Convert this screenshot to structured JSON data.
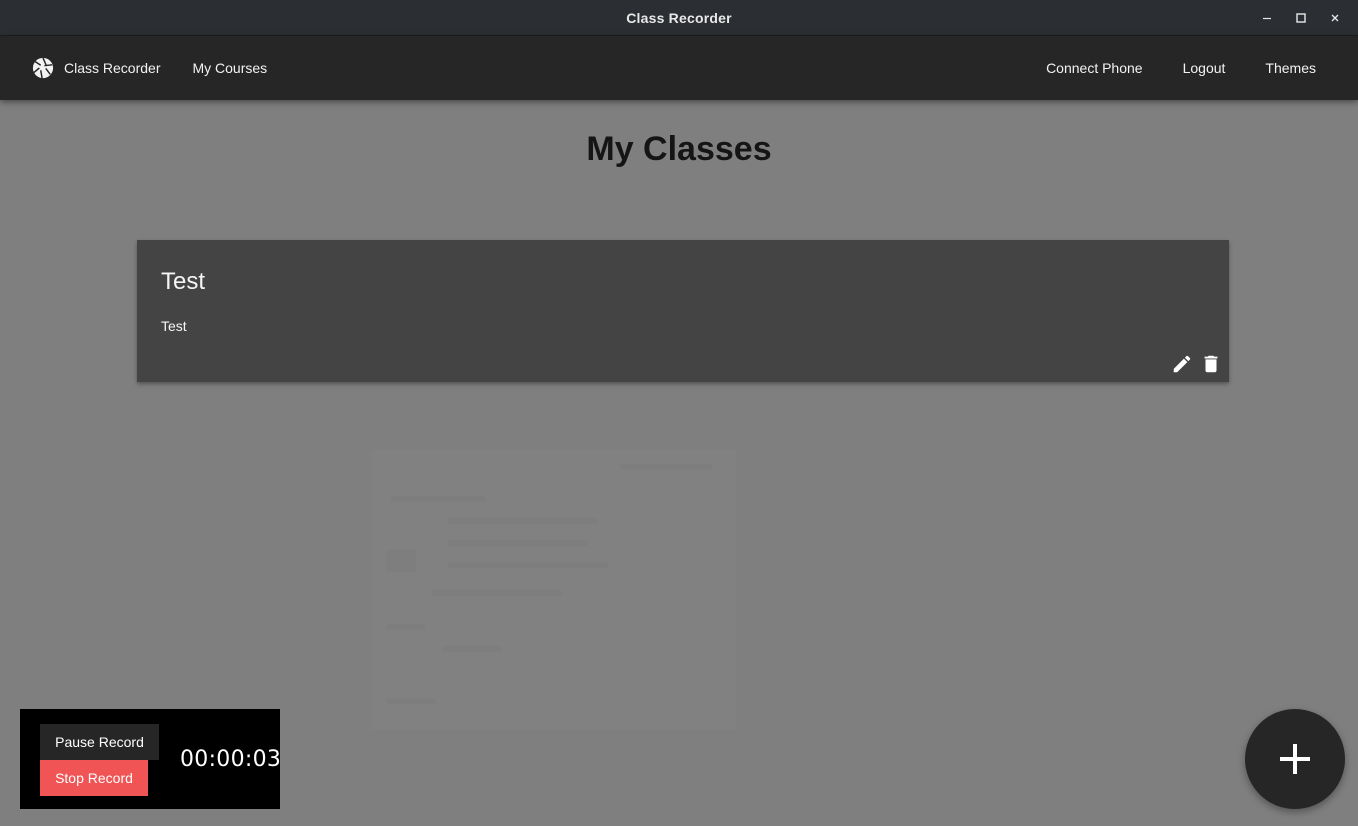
{
  "window": {
    "title": "Class Recorder",
    "controls": {
      "minimize_icon": "minimize-icon",
      "maximize_icon": "maximize-icon",
      "close_icon": "close-icon"
    }
  },
  "navbar": {
    "brand_label": "Class Recorder",
    "brand_icon": "aperture-icon",
    "left_links": [
      "My Courses"
    ],
    "right_links": [
      "Connect Phone",
      "Logout",
      "Themes"
    ]
  },
  "page": {
    "title": "My Classes"
  },
  "classes": [
    {
      "title": "Test",
      "description": "Test",
      "actions": [
        "edit-icon",
        "delete-icon"
      ]
    }
  ],
  "recorder": {
    "pause_label": "Pause Record",
    "stop_label": "Stop Record",
    "elapsed": "00:00:03"
  },
  "fab": {
    "icon": "plus-icon"
  },
  "colors": {
    "titlebar": "#2b2e32",
    "navbar": "#262626",
    "background": "#7f7f7f",
    "card": "#444444",
    "stop_button": "#f05454",
    "recorder_panel": "#000000"
  }
}
